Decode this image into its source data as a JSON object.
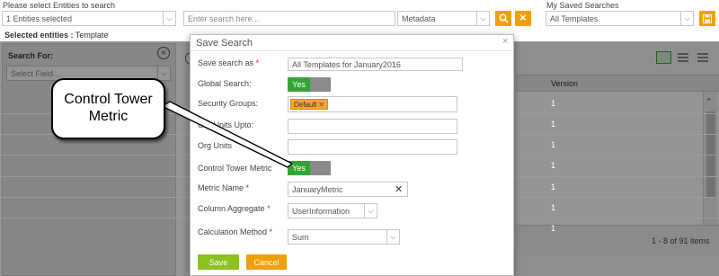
{
  "top": {
    "entities_label": "Please select Entities to search",
    "entities_value": "1 Entities selected",
    "search_placeholder": "Enter search here...",
    "metadata_value": "Metadata",
    "saved_label": "My Saved Searches",
    "saved_value": "All Templates",
    "selected_label": "Selected entities :",
    "selected_value": "Template"
  },
  "left_panel": {
    "title": "Search For:",
    "field_placeholder": "Select Field...",
    "collapse_icon": "«"
  },
  "grid": {
    "version_header": "Version",
    "rows": [
      "1",
      "1",
      "1",
      "1",
      "1",
      "1",
      "1"
    ],
    "pager_text": "1 - 8 of 91 items"
  },
  "modal": {
    "title": "Save Search",
    "close": "×",
    "save_as_label": "Save search as",
    "save_as_value": "All Templates for January2016",
    "global_label": "Global Search:",
    "global_toggle": "Yes",
    "security_label": "Security Groups:",
    "security_tag": "Default",
    "org_units_upto_label": "Org Units Upto:",
    "org_units_label": "Org Units",
    "control_tower_label": "Control Tower Metric",
    "control_tower_toggle": "Yes",
    "metric_name_label": "Metric Name",
    "metric_name_value": "JanuaryMetric",
    "column_aggregate_label": "Column Aggregate",
    "column_aggregate_value": "UserInformation",
    "calc_method_label": "Calculation Method",
    "calc_method_value": "Sum",
    "required_mark": "*",
    "save_button": "Save",
    "cancel_button": "Cancel"
  },
  "callout": {
    "line1": "Control Tower",
    "line2": "Metric"
  },
  "colors": {
    "accent_orange": "#f0a000",
    "toggle_green": "#33a532",
    "save_green": "#8cc31f",
    "cancel_orange": "#f0a000",
    "required_red": "#d9232d",
    "tag_orange": "#f5a623"
  }
}
